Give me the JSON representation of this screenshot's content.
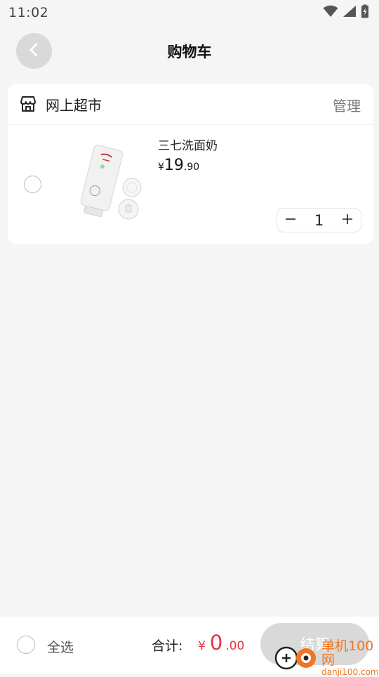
{
  "status_bar": {
    "time": "11:02"
  },
  "header": {
    "title": "购物车"
  },
  "store": {
    "name": "网上超市",
    "manage_label": "管理",
    "items": [
      {
        "name": "三七洗面奶",
        "price_symbol": "¥",
        "price_integer": "19",
        "price_decimal": ".90",
        "quantity": "1"
      }
    ]
  },
  "footer": {
    "select_all_label": "全选",
    "total_label": "合计:",
    "total_symbol": "¥",
    "total_integer": "0",
    "total_decimal": ".00",
    "checkout_label": "结算"
  },
  "watermark": {
    "cn": "单机100网",
    "en": "danji100.com"
  },
  "colors": {
    "accent_red": "#e8343f",
    "background": "#f5f5f5",
    "disabled_button": "#d9d9d9",
    "watermark_orange": "#f0761f"
  },
  "icons": {
    "back": "chevron-left-icon",
    "store": "store-icon",
    "minus": "minus-icon",
    "plus": "plus-icon",
    "wifi": "wifi-icon",
    "signal": "signal-icon",
    "battery": "battery-icon"
  }
}
